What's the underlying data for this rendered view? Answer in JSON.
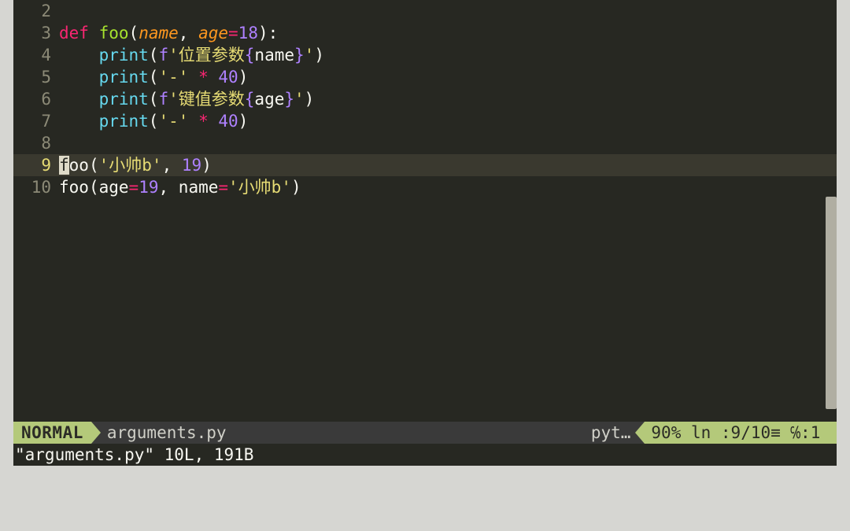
{
  "gutter": {
    "l2": "2",
    "l3": "3",
    "l4": "4",
    "l5": "5",
    "l6": "6",
    "l7": "7",
    "l8": "8",
    "l9": "9",
    "l10": "10"
  },
  "code": {
    "def": "def",
    "foo": "foo",
    "name": "name",
    "age": "age",
    "eq": "=",
    "num18": "18",
    "num19": "19",
    "num40": "40",
    "print": "print",
    "lp": "(",
    "rp": ")",
    "colon": ":",
    "comma": ",",
    "sp": " ",
    "indent": "    ",
    "f": "f",
    "q": "'",
    "s_pos": "位置参数",
    "s_kv": "键值参数",
    "lb": "{",
    "rb": "}",
    "name_i": "name",
    "age_i": "age",
    "dash": "-",
    "star": "*",
    "xiaoshuaib": "小帅b",
    "foo_cursor": "f",
    "foo_rest": "oo"
  },
  "status": {
    "mode": "NORMAL",
    "filename": "arguments.py",
    "filetype": "pyt…",
    "percent": "90%",
    "pos": " ln :9/10≡ ℅:1 "
  },
  "cmdline": "\"arguments.py\" 10L, 191B"
}
